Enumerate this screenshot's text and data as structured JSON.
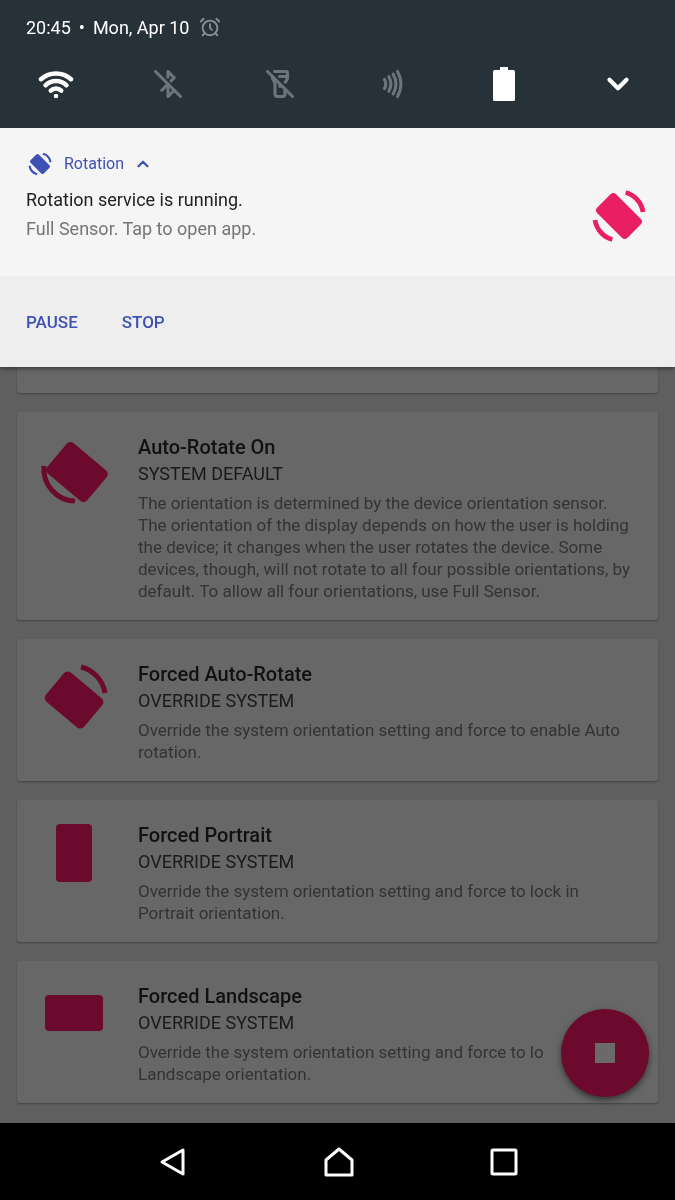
{
  "status_bar": {
    "time": "20:45",
    "separator": "•",
    "date": "Mon, Apr 10"
  },
  "quick_settings": [
    {
      "kind": "wifi",
      "on": true
    },
    {
      "kind": "bluetooth",
      "on": false
    },
    {
      "kind": "flashlight",
      "on": false
    },
    {
      "kind": "nfc",
      "on": false
    },
    {
      "kind": "battery",
      "on": true
    }
  ],
  "notification": {
    "app": "Rotation",
    "expanded": true,
    "title": "Rotation service is running.",
    "text": "Full Sensor. Tap to open app.",
    "actions": [
      "PAUSE",
      "STOP"
    ]
  },
  "cards": [
    {
      "kind": "auto",
      "title": "Auto-Rotate On",
      "subtitle": "SYSTEM DEFAULT",
      "description": "The orientation is determined by the device orientation sensor. The orientation of the display depends on how the user is holding the device; it changes when the user rotates the device. Some devices, though, will not rotate to all four possible orientations, by default. To allow all four orientations, use Full Sensor."
    },
    {
      "kind": "forced-auto",
      "title": "Forced Auto-Rotate",
      "subtitle": "OVERRIDE SYSTEM",
      "description": "Override the system orientation setting and force to enable Auto rotation."
    },
    {
      "kind": "portrait",
      "title": "Forced Portrait",
      "subtitle": "OVERRIDE SYSTEM",
      "description": "Override the system orientation setting and force to lock in Portrait orientation."
    },
    {
      "kind": "landscape",
      "title": "Forced Landscape",
      "subtitle": "OVERRIDE SYSTEM",
      "description": "Override the system orientation setting and force to lo\nLandscape orientation."
    }
  ]
}
